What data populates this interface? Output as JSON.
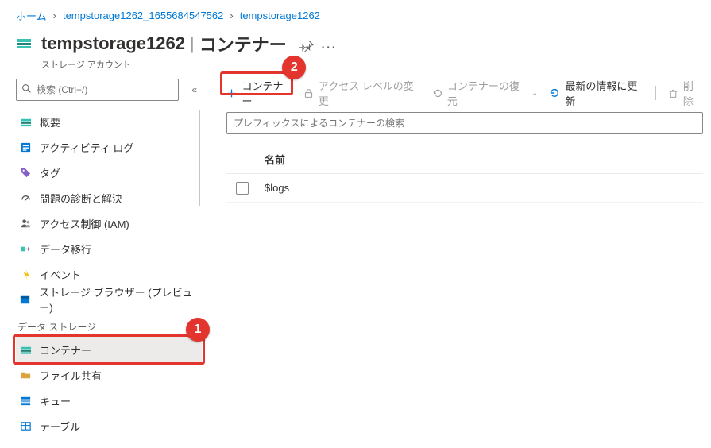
{
  "breadcrumb": [
    {
      "label": "ホーム"
    },
    {
      "label": "tempstorage1262_1655684547562"
    },
    {
      "label": "tempstorage1262"
    }
  ],
  "header": {
    "title_left": "tempstorage1262",
    "title_sep": "|",
    "title_right": "コンテナー",
    "subtitle": "ストレージ アカウント"
  },
  "sidebar": {
    "search_placeholder": "検索 (Ctrl+/)",
    "items": [
      {
        "label": "概要",
        "icon": "overview"
      },
      {
        "label": "アクティビティ ログ",
        "icon": "activity"
      },
      {
        "label": "タグ",
        "icon": "tag"
      },
      {
        "label": "問題の診断と解決",
        "icon": "diagnose"
      },
      {
        "label": "アクセス制御 (IAM)",
        "icon": "iam"
      },
      {
        "label": "データ移行",
        "icon": "migrate"
      },
      {
        "label": "イベント",
        "icon": "event"
      },
      {
        "label": "ストレージ ブラウザー (プレビュー)",
        "icon": "browser"
      }
    ],
    "section_label": "データ ストレージ",
    "storage_items": [
      {
        "label": "コンテナー",
        "icon": "container",
        "selected": true
      },
      {
        "label": "ファイル共有",
        "icon": "fileshare"
      },
      {
        "label": "キュー",
        "icon": "queue"
      },
      {
        "label": "テーブル",
        "icon": "table"
      }
    ]
  },
  "toolbar": {
    "add": "コンテナー",
    "change_access": "アクセス レベルの変更",
    "restore": "コンテナーの復元",
    "refresh": "最新の情報に更新",
    "delete": "削除"
  },
  "filter_placeholder": "プレフィックスによるコンテナーの検索",
  "table": {
    "col_name": "名前",
    "rows": [
      {
        "name": "$logs"
      }
    ]
  },
  "annotations": {
    "badge1": "1",
    "badge2": "2"
  }
}
